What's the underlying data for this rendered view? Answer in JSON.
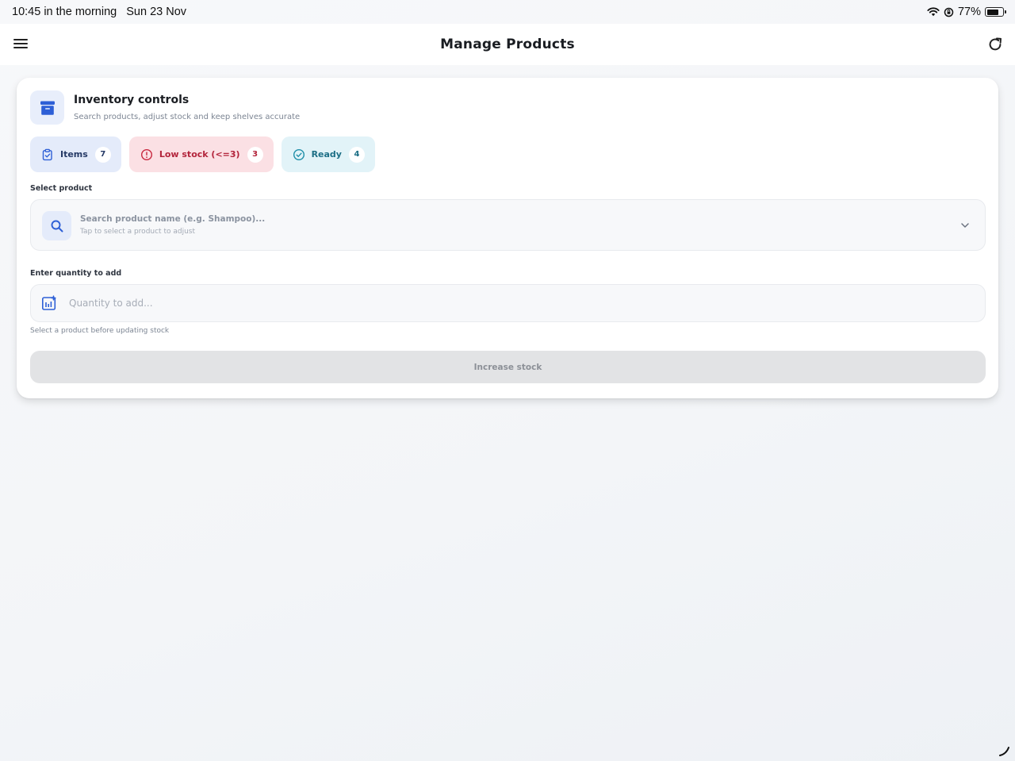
{
  "status_bar": {
    "time": "10:45 in the morning",
    "date": "Sun 23 Nov",
    "battery": "77%",
    "battery_level": 0.77
  },
  "header": {
    "title": "Manage Products"
  },
  "card": {
    "title": "Inventory controls",
    "subtitle": "Search products, adjust stock and keep shelves accurate"
  },
  "chips": [
    {
      "label": "Items",
      "count": "7",
      "icon": "clipboard-check-icon"
    },
    {
      "label": "Low stock (<=3)",
      "count": "3",
      "icon": "alert-circle-icon"
    },
    {
      "label": "Ready",
      "count": "4",
      "icon": "check-circle-icon"
    }
  ],
  "product_select": {
    "label": "Select product",
    "placeholder": "Search product name (e.g. Shampoo)...",
    "hint": "Tap to select a product to adjust"
  },
  "quantity": {
    "label": "Enter quantity to add",
    "placeholder": "Quantity to add...",
    "helper": "Select a product before updating stock"
  },
  "actions": {
    "increase_label": "Increase stock"
  },
  "colors": {
    "accent": "#2d5fd6",
    "low_stock": "#b3243b",
    "ready": "#1d6f86",
    "disabled_button": "#e2e3e5"
  }
}
